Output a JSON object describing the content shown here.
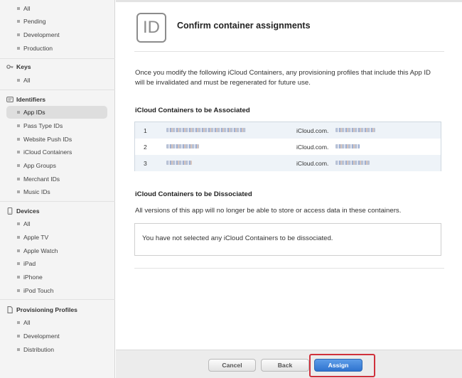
{
  "sidebar": {
    "top_items": [
      "All",
      "Pending",
      "Development",
      "Production"
    ],
    "keys": {
      "heading": "Keys",
      "items": [
        "All"
      ]
    },
    "identifiers": {
      "heading": "Identifiers",
      "items": [
        "App IDs",
        "Pass Type IDs",
        "Website Push IDs",
        "iCloud Containers",
        "App Groups",
        "Merchant IDs",
        "Music IDs"
      ],
      "selected": "App IDs"
    },
    "devices": {
      "heading": "Devices",
      "items": [
        "All",
        "Apple TV",
        "Apple Watch",
        "iPad",
        "iPhone",
        "iPod Touch"
      ]
    },
    "profiles": {
      "heading": "Provisioning Profiles",
      "items": [
        "All",
        "Development",
        "Distribution"
      ]
    }
  },
  "main": {
    "badge": "ID",
    "title": "Confirm container assignments",
    "description": "Once you modify the following iCloud Containers, any provisioning profiles that include this App ID will be invalidated and must be regenerated for future use.",
    "associated": {
      "heading": "iCloud Containers to be Associated",
      "rows": [
        {
          "num": "1",
          "container": "iCloud.com."
        },
        {
          "num": "2",
          "container": "iCloud.com."
        },
        {
          "num": "3",
          "container": "iCloud.com."
        }
      ]
    },
    "dissociated": {
      "heading": "iCloud Containers to be Dissociated",
      "description": "All versions of this app will no longer be able to store or access data in these containers.",
      "empty_message": "You have not selected any iCloud Containers to be dissociated."
    }
  },
  "footer": {
    "cancel": "Cancel",
    "back": "Back",
    "assign": "Assign"
  },
  "colors": {
    "primary_button": "#2f73cf",
    "highlight_outline": "#d0313c",
    "row_alt": "#eef3f8"
  }
}
